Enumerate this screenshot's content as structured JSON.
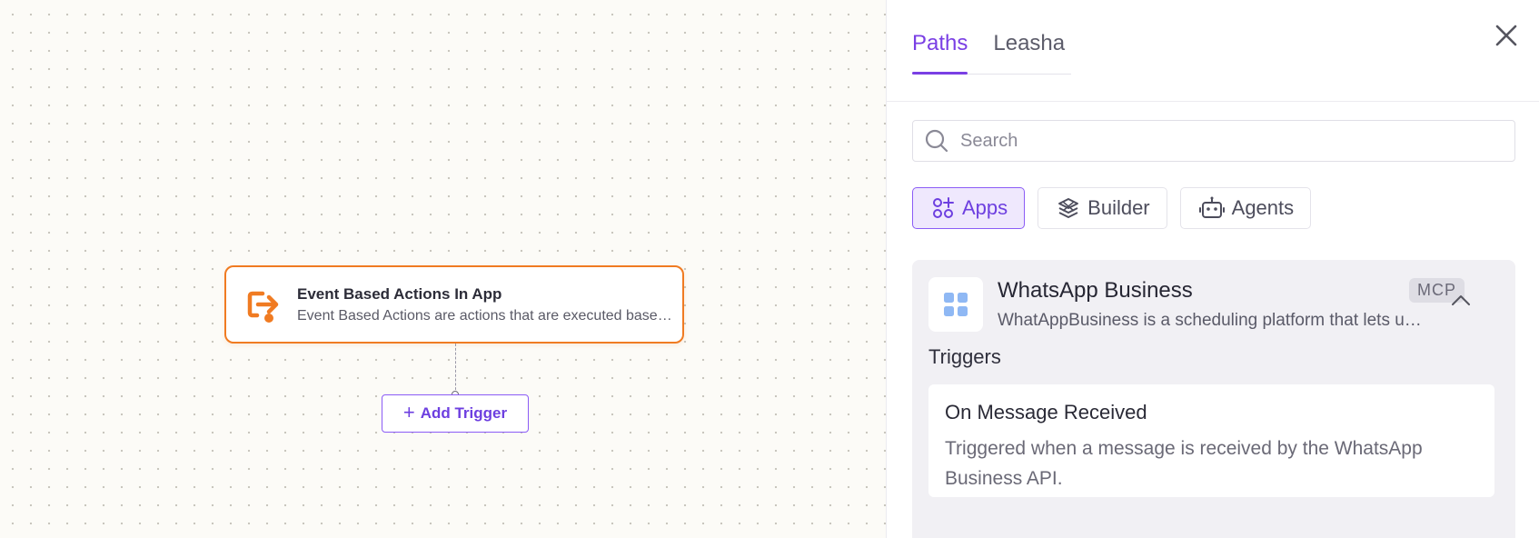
{
  "canvas": {
    "node": {
      "title": "Event Based Actions In App",
      "description": "Event Based Actions are actions that are executed based on specific events happening in apps",
      "accent": "#f07b22"
    },
    "add_trigger_label": "Add Trigger"
  },
  "panel": {
    "tabs": [
      {
        "label": "Paths",
        "active": true
      },
      {
        "label": "Leasha",
        "active": false
      }
    ],
    "search": {
      "placeholder": "Search",
      "value": ""
    },
    "filters": [
      {
        "label": "Apps",
        "icon": "apps-icon",
        "active": true
      },
      {
        "label": "Builder",
        "icon": "builder-icon",
        "active": false
      },
      {
        "label": "Agents",
        "icon": "robot-icon",
        "active": false
      }
    ],
    "app": {
      "name": "WhatsApp Business",
      "description": "WhatAppBusiness is a scheduling platform that lets users",
      "badge": "MCP",
      "triggers_heading": "Triggers",
      "triggers": [
        {
          "title": "On Message Received",
          "description": "Triggered when a message is received by the WhatsApp Business API."
        }
      ]
    }
  },
  "colors": {
    "accent_purple": "#7a3fe4",
    "node_orange": "#f07b22"
  }
}
